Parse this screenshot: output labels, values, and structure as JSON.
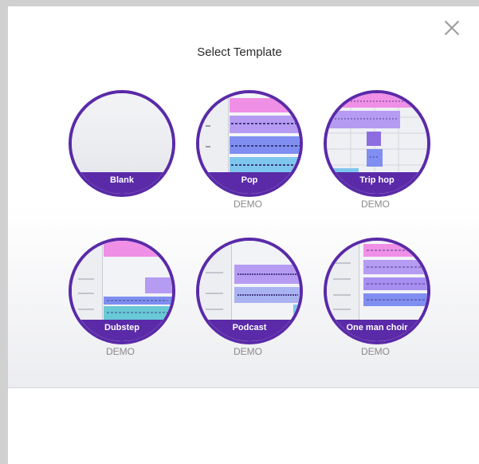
{
  "dialog": {
    "title": "Select Template",
    "close_label": "close"
  },
  "templates": [
    {
      "label": "Blank",
      "demo": ""
    },
    {
      "label": "Pop",
      "demo": "DEMO"
    },
    {
      "label": "Trip hop",
      "demo": "DEMO"
    },
    {
      "label": "Dubstep",
      "demo": "DEMO"
    },
    {
      "label": "Podcast",
      "demo": "DEMO"
    },
    {
      "label": "One man choir",
      "demo": "DEMO"
    }
  ],
  "colors": {
    "accent": "#5a2aa8",
    "pink": "#f08fe6",
    "lavender": "#b69bf2",
    "periwinkle": "#7f8ef0",
    "sky": "#7fc6ee",
    "teal": "#69c9d6"
  }
}
